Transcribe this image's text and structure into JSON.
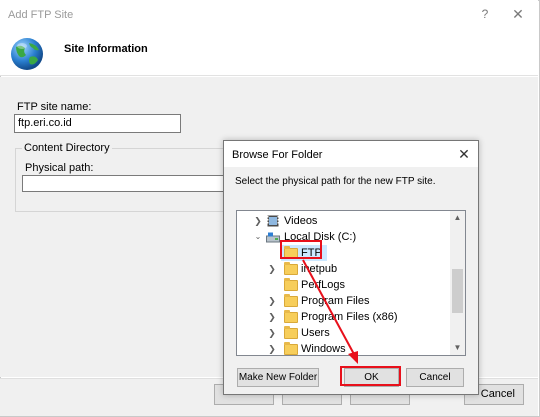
{
  "outer_dialog": {
    "title": "Add FTP Site",
    "help_glyph": "?",
    "close_glyph": "✕",
    "header_title": "Site Information",
    "ftp_site_name_label": "FTP site name:",
    "ftp_site_name_value": "ftp.eri.co.id",
    "content_directory_legend": "Content Directory",
    "physical_path_label": "Physical path:",
    "physical_path_value": "",
    "cancel_label": "Cancel"
  },
  "browse_dialog": {
    "title": "Browse For Folder",
    "close_glyph": "✕",
    "instruction": "Select the physical path for the new FTP site.",
    "tree": [
      {
        "label": "Videos",
        "chevron": ">",
        "icon": "videos-folder-icon"
      },
      {
        "label": "Local Disk (C:)",
        "chevron": "v",
        "icon": "drive-icon"
      },
      {
        "label": "FTP",
        "chevron": "",
        "icon": "folder-icon",
        "selected": true
      },
      {
        "label": "inetpub",
        "chevron": ">",
        "icon": "folder-icon"
      },
      {
        "label": "PerfLogs",
        "chevron": "",
        "icon": "folder-icon"
      },
      {
        "label": "Program Files",
        "chevron": ">",
        "icon": "folder-icon"
      },
      {
        "label": "Program Files (x86)",
        "chevron": ">",
        "icon": "folder-icon"
      },
      {
        "label": "Users",
        "chevron": ">",
        "icon": "folder-icon"
      },
      {
        "label": "Windows",
        "chevron": ">",
        "icon": "folder-icon"
      }
    ],
    "scroll_up_glyph": "▲",
    "scroll_down_glyph": "▼",
    "make_new_folder_label": "Make New Folder",
    "ok_label": "OK",
    "cancel_label": "Cancel"
  },
  "annotations": {
    "highlight_color": "#e8101b"
  }
}
